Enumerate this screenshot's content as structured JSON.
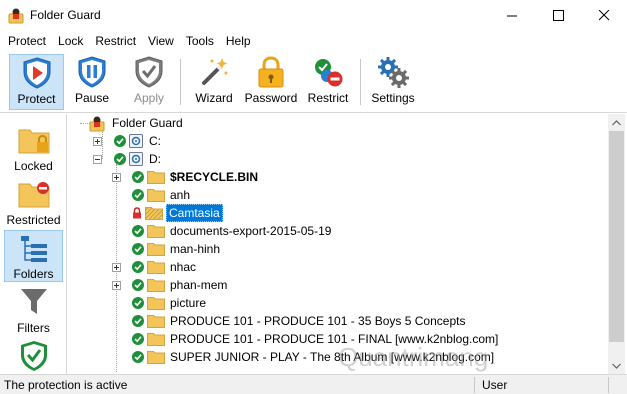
{
  "window": {
    "title": "Folder Guard",
    "minimize_icon": "minimize-icon",
    "maximize_icon": "maximize-icon",
    "close_icon": "close-icon"
  },
  "menu": [
    {
      "label": "Protect",
      "accel": "P"
    },
    {
      "label": "Lock",
      "accel": "L"
    },
    {
      "label": "Restrict",
      "accel": "R"
    },
    {
      "label": "View",
      "accel": "V"
    },
    {
      "label": "Tools",
      "accel": "T"
    },
    {
      "label": "Help",
      "accel": "H"
    }
  ],
  "toolbar": {
    "protect": {
      "label": "Protect",
      "icon": "shield-play-icon",
      "active": true
    },
    "pause": {
      "label": "Pause",
      "icon": "shield-pause-icon"
    },
    "apply": {
      "label": "Apply",
      "icon": "shield-check-icon",
      "disabled": true
    },
    "wizard": {
      "label": "Wizard",
      "icon": "magic-wand-icon"
    },
    "password": {
      "label": "Password",
      "icon": "padlock-icon"
    },
    "restrict": {
      "label": "Restrict",
      "icon": "check-block-icon"
    },
    "settings": {
      "label": "Settings",
      "icon": "gears-icon"
    }
  },
  "leftnav": {
    "locked": {
      "label": "Locked",
      "icon": "locked-folder-icon"
    },
    "restricted": {
      "label": "Restricted",
      "icon": "restricted-folder-icon"
    },
    "folders": {
      "label": "Folders",
      "icon": "folder-tree-icon",
      "active": true
    },
    "filters": {
      "label": "Filters",
      "icon": "funnel-icon"
    },
    "trusted": {
      "icon": "shield-check-icon"
    }
  },
  "tree": {
    "root": "Folder Guard",
    "drive_c": "C:",
    "drive_d": "D:",
    "items": [
      {
        "label": "$RECYCLE.BIN",
        "bold": true,
        "expandable": true,
        "status": "ok"
      },
      {
        "label": "anh",
        "status": "ok"
      },
      {
        "label": "Camtasia",
        "status": "locked",
        "selected": true
      },
      {
        "label": "documents-export-2015-05-19",
        "status": "ok"
      },
      {
        "label": "man-hinh",
        "status": "ok"
      },
      {
        "label": "nhac",
        "expandable": true,
        "status": "ok"
      },
      {
        "label": "phan-mem",
        "expandable": true,
        "status": "ok"
      },
      {
        "label": "picture",
        "status": "ok"
      },
      {
        "label": "PRODUCE 101 - PRODUCE 101 - 35 Boys 5 Concepts",
        "status": "ok"
      },
      {
        "label": "PRODUCE 101 - PRODUCE 101 - FINAL [www.k2nblog.com]",
        "status": "ok"
      },
      {
        "label": "SUPER JUNIOR - PLAY - The 8th Album [www.k2nblog.com]",
        "status": "ok"
      }
    ]
  },
  "watermark": "Quantrimang",
  "status": {
    "text": "The protection is active",
    "user": "User"
  },
  "colors": {
    "accent_bg": "#cce4f7",
    "accent_border": "#99c9ef",
    "selection": "#0078d7",
    "folder": "#f3c55a",
    "check_green": "#1f8f3a"
  }
}
